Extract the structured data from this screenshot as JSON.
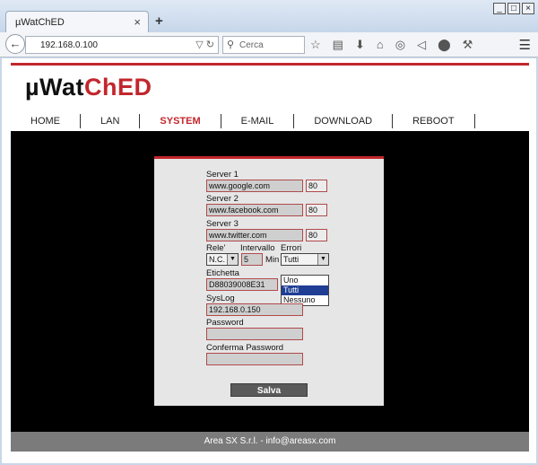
{
  "browser": {
    "tab_title": "µWatChED",
    "tab_close": "×",
    "new_tab": "+",
    "url": "192.168.0.100",
    "search_placeholder": "Cerca"
  },
  "page": {
    "logo_part1": "µWat",
    "logo_part2": "ChED",
    "menu": [
      {
        "label": "HOME",
        "active": false
      },
      {
        "label": "LAN",
        "active": false
      },
      {
        "label": "SYSTEM",
        "active": true
      },
      {
        "label": "E-MAIL",
        "active": false
      },
      {
        "label": "DOWNLOAD",
        "active": false
      },
      {
        "label": "REBOOT",
        "active": false
      }
    ]
  },
  "form": {
    "server1_label": "Server 1",
    "server1_value": "www.google.com",
    "server1_port": "80",
    "server2_label": "Server 2",
    "server2_value": "www.facebook.com",
    "server2_port": "80",
    "server3_label": "Server 3",
    "server3_value": "www.twitter.com",
    "server3_port": "80",
    "rele_label": "Rele'",
    "rele_value": "N.C.",
    "intervallo_label": "Intervallo",
    "intervallo_value": "5",
    "intervallo_unit": "Min",
    "errori_label": "Errori",
    "errori_value": "Tutti",
    "errori_options": [
      "Uno",
      "Tutti",
      "Nessuno"
    ],
    "errori_selected_index": 1,
    "etichetta_label": "Etichetta",
    "etichetta_value": "D88039008E31",
    "syslog_label": "SysLog",
    "syslog_value": "192.168.0.150",
    "password_label": "Password",
    "password_value": "",
    "confirm_label": "Conferma Password",
    "confirm_value": "",
    "save_label": "Salva"
  },
  "footer": {
    "text": "Area SX S.r.l. - info@areasx.com"
  },
  "colors": {
    "accent": "#c1272d",
    "panel": "#e6e6e6",
    "footer": "#7b7b7b",
    "dropdown_selected": "#1f3e94"
  }
}
